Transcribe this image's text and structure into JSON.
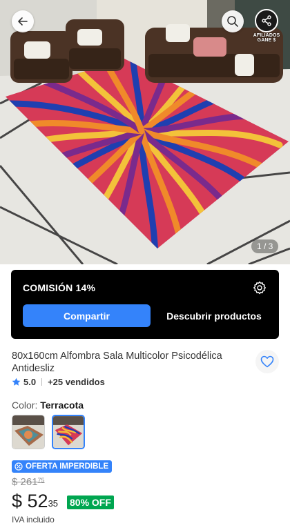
{
  "hero": {
    "pager": "1 / 3",
    "share_caption": "AFILIADOS GANE $"
  },
  "affiliate": {
    "commission": "COMISIÓN 14%",
    "share_label": "Compartir",
    "discover_label": "Descubrir productos"
  },
  "product": {
    "title": "80x160cm Alfombra Sala Multicolor Psicodélica Antidesliz",
    "rating": "5.0",
    "sold": "+25 vendidos",
    "color_label": "Color:",
    "color_value": "Terracota",
    "deal_badge": "OFERTA IMPERDIBLE",
    "old_price_int": "$ 261",
    "old_price_dec": "75",
    "price_int": "$ 52",
    "price_dec": "35",
    "discount": "80% OFF",
    "tax_note": "IVA incluido"
  },
  "colors": {
    "accent": "#3483fa",
    "discount_green": "#00a650",
    "card_bg": "#000000"
  },
  "icons": [
    "arrow-left-icon",
    "search-icon",
    "share-icon",
    "gear-icon",
    "heart-icon",
    "star-icon",
    "deal-icon"
  ]
}
